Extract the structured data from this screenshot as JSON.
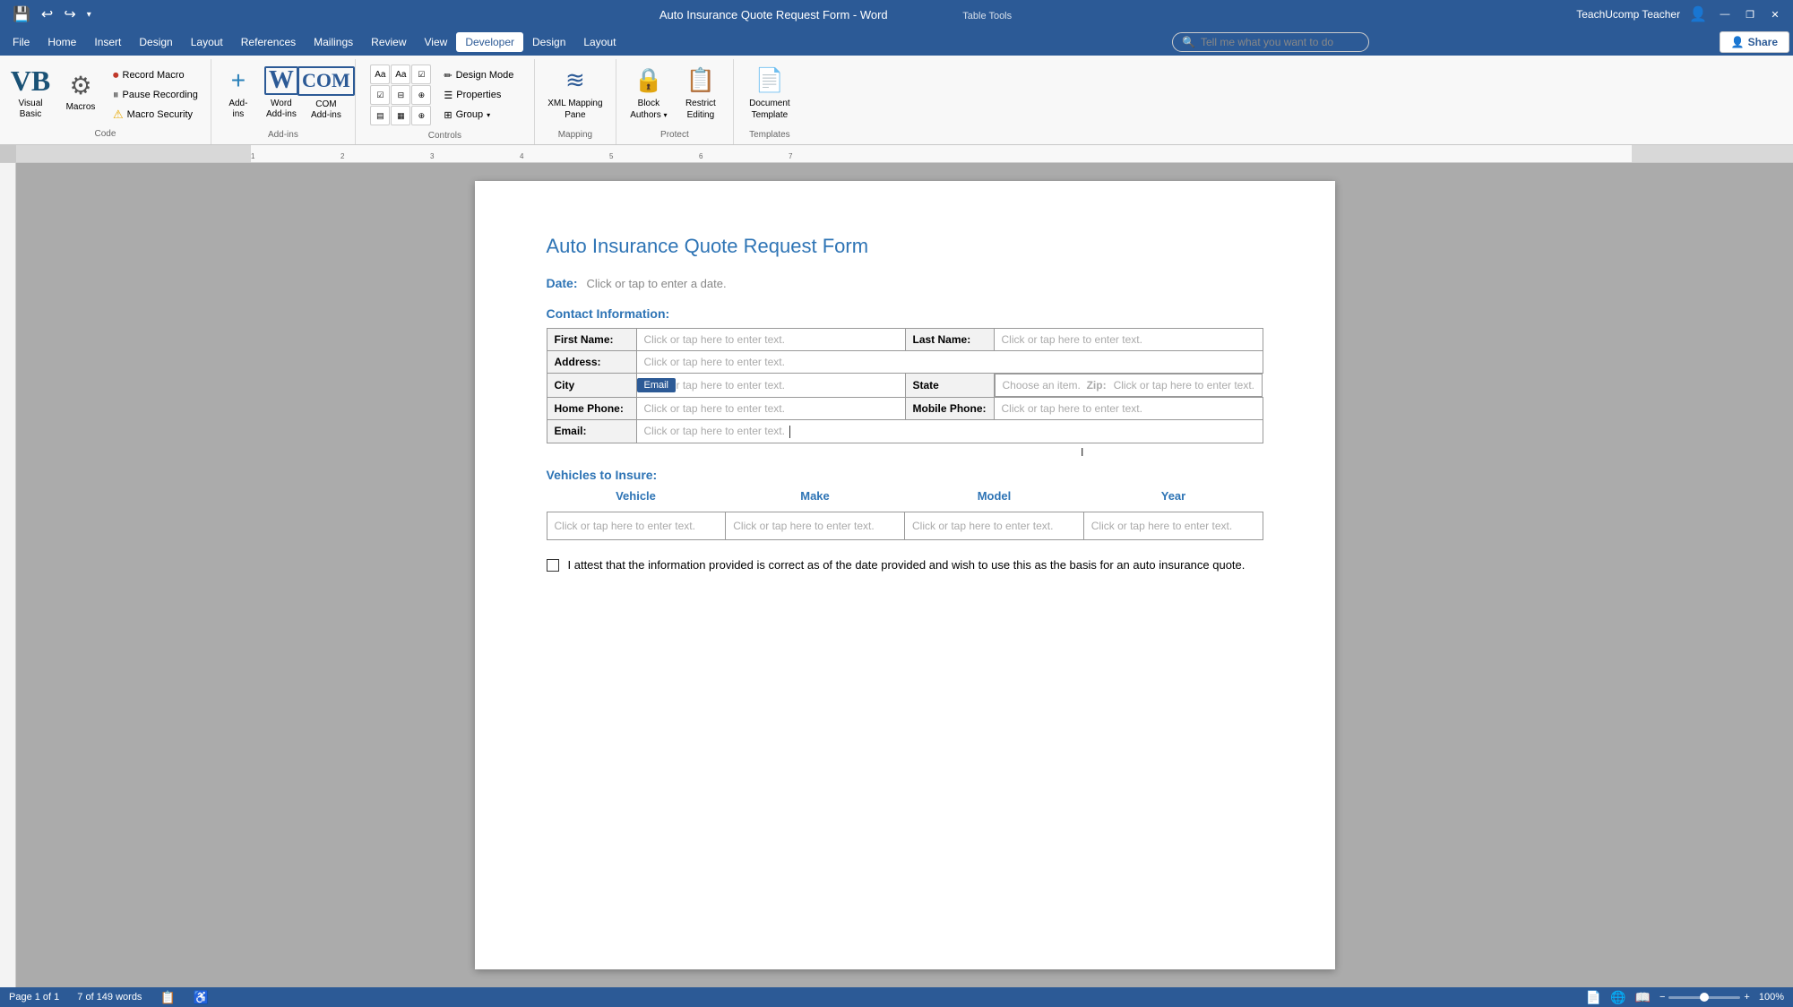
{
  "titlebar": {
    "title": "Auto Insurance Quote Request Form - Word",
    "context": "Table Tools",
    "user": "TeachUcomp Teacher",
    "minimize": "—",
    "restore": "❐",
    "close": "✕"
  },
  "quickaccess": {
    "save": "💾",
    "undo": "↩",
    "redo": "↪",
    "dropdown": "▾"
  },
  "menubar": {
    "items": [
      "File",
      "Home",
      "Insert",
      "Design",
      "Layout",
      "References",
      "Mailings",
      "Review",
      "View",
      "Developer",
      "Design",
      "Layout"
    ]
  },
  "ribbon": {
    "groups": {
      "code": {
        "label": "Code",
        "visualbasic": "Visual\nBasic",
        "macros": "Macros",
        "record_macro": "Record Macro",
        "pause_recording": "Pause Recording",
        "macro_security": "Macro Security"
      },
      "addins": {
        "label": "Add-ins",
        "add_ins": "Add-\nins",
        "word_add_ins": "Word\nAdd-ins",
        "com_add_ins": "COM\nAdd-ins"
      },
      "controls": {
        "label": "Controls",
        "design_mode": "Design Mode",
        "properties": "Properties",
        "group": "Group"
      },
      "mapping": {
        "label": "Mapping",
        "xml_mapping_pane": "XML Mapping\nPane"
      },
      "protect": {
        "label": "Protect",
        "block_authors": "Block\nAuthors",
        "restrict_editing": "Restrict\nEditing"
      },
      "templates": {
        "label": "Templates",
        "document_template": "Document\nTemplate"
      }
    }
  },
  "searchbar": {
    "placeholder": "Tell me what you want to do"
  },
  "share": {
    "label": "Share"
  },
  "document": {
    "title": "Auto Insurance Quote Request Form",
    "date_label": "Date:",
    "date_placeholder": "Click or tap to enter a date.",
    "contact_section": "Contact Information:",
    "table": {
      "first_name_label": "First Name:",
      "first_name_placeholder": "Click or tap here to enter text.",
      "last_name_label": "Last Name:",
      "last_name_placeholder": "Click or tap here to enter text.",
      "address_label": "Address:",
      "address_placeholder": "Click or tap here to enter text.",
      "city_label": "City",
      "city_placeholder": "Click or tap here to enter text.",
      "state_label": "State",
      "state_placeholder": "Choose an item.",
      "zip_label": "Zip:",
      "zip_placeholder": "Click or tap here to enter text.",
      "home_phone_label": "Home Phone:",
      "home_phone_placeholder": "Click or tap here to enter text.",
      "mobile_phone_label": "Mobile Phone:",
      "mobile_phone_placeholder": "Click or tap here to enter text.",
      "email_tooltip": "Email",
      "email_label": "Email:",
      "email_placeholder": "Click or tap here to enter text."
    },
    "vehicles_section": "Vehicles to Insure:",
    "vehicles_col_vehicle": "Vehicle",
    "vehicles_col_make": "Make",
    "vehicles_col_model": "Model",
    "vehicles_col_year": "Year",
    "vehicles_row": {
      "vehicle": "Click or tap here to enter text.",
      "make": "Click or tap here to enter text.",
      "model": "Click or tap here to enter text.",
      "year": "Click or tap here to enter text."
    },
    "attestation": "I attest that the information provided is correct as of the date provided and wish to use this as the basis for an auto insurance quote."
  },
  "statusbar": {
    "page": "Page 1 of 1",
    "words": "7 of 149 words",
    "zoom": "100%"
  },
  "icons": {
    "visual_basic": "⌨",
    "macros": "⚙",
    "record": "⏺",
    "pause": "⏸",
    "warning": "⚠",
    "add_ins": "➕",
    "word_icon": "W",
    "com_icon": "C",
    "design_mode": "✏",
    "properties": "☰",
    "group": "⊞",
    "xml": "≋",
    "lock": "🔒",
    "restrict": "📋",
    "document": "📄",
    "share_icon": "👤",
    "search": "🔍",
    "save": "💾",
    "undo": "↩",
    "redo": "↪"
  }
}
